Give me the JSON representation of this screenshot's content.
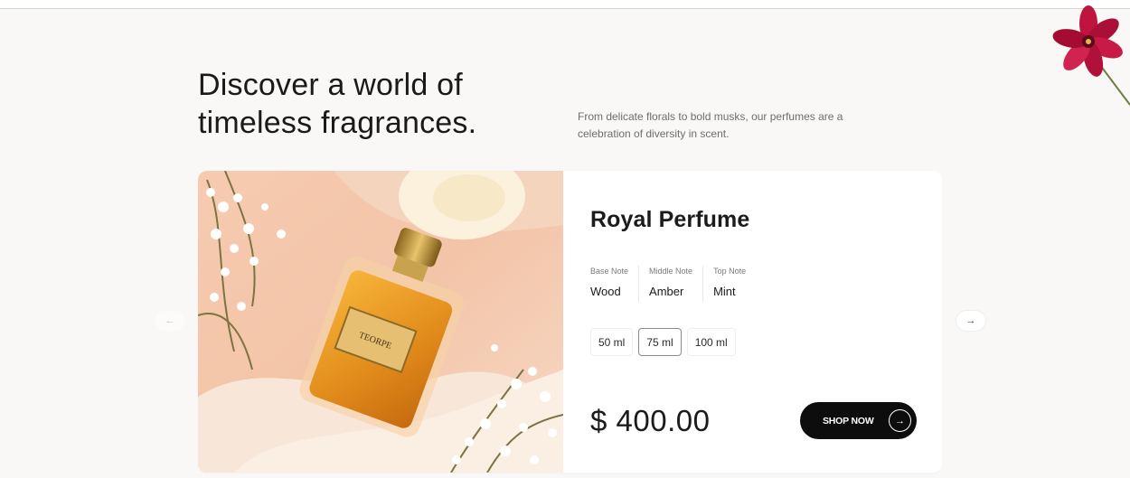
{
  "headline": {
    "line1": "Discover a world of",
    "line2": "timeless fragrances."
  },
  "subtext": "From delicate florals to bold musks, our perfumes are a celebration of diversity in scent.",
  "product": {
    "name": "Royal Perfume",
    "bottle_label": "TEORPE",
    "notes": [
      {
        "label": "Base Note",
        "value": "Wood"
      },
      {
        "label": "Middle Note",
        "value": "Amber"
      },
      {
        "label": "Top Note",
        "value": "Mint"
      }
    ],
    "sizes": [
      {
        "label": "50 ml",
        "selected": false
      },
      {
        "label": "75 ml",
        "selected": true
      },
      {
        "label": "100 ml",
        "selected": false
      }
    ],
    "price": "$ 400.00"
  },
  "shop_button": {
    "label": "SHOP NOW",
    "icon": "arrow-right-icon",
    "arrow": "→"
  },
  "carousel": {
    "prev_icon": "arrow-left-icon",
    "prev_glyph": "←",
    "next_icon": "arrow-right-icon",
    "next_glyph": "→"
  },
  "colors": {
    "background": "#faf8f6",
    "card": "#ffffff",
    "button": "#0d0d0d",
    "flower": "#b5103a"
  }
}
